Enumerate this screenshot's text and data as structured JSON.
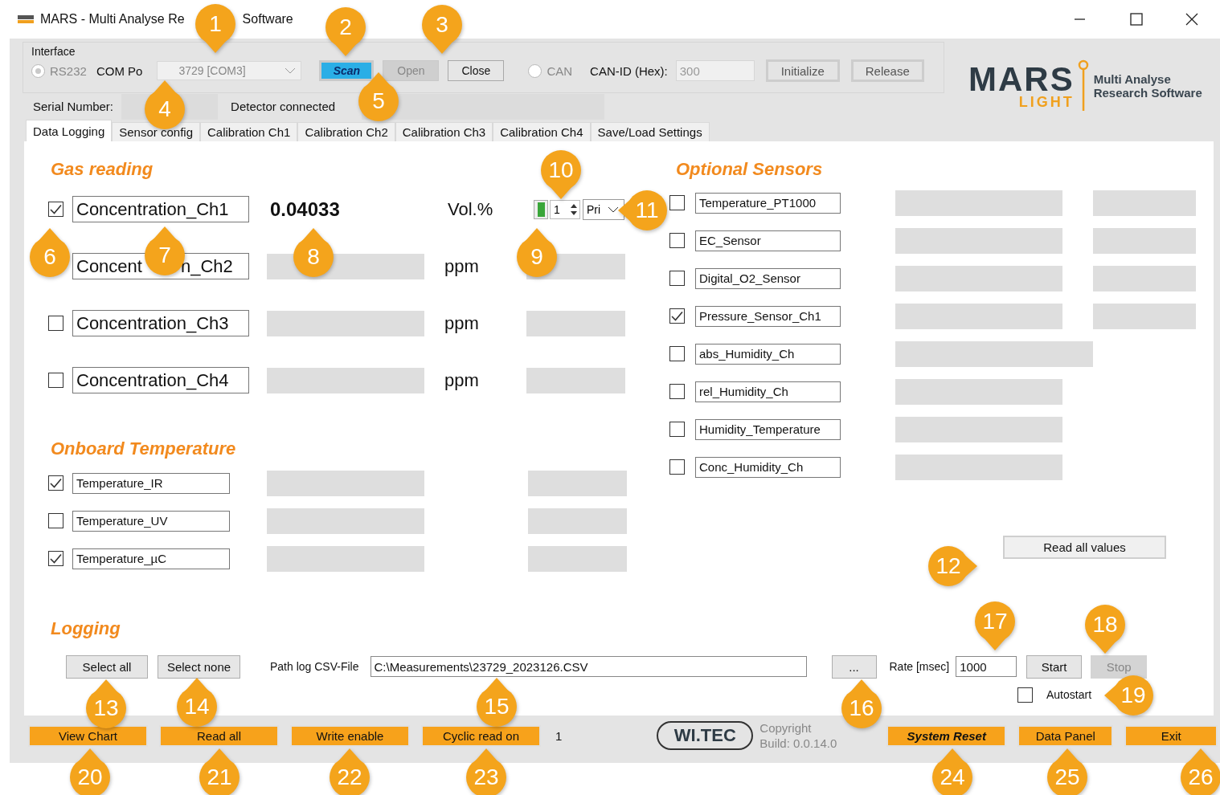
{
  "window": {
    "title_parts": [
      "MARS - Multi Analyse Re",
      "Software"
    ]
  },
  "interface": {
    "label": "Interface",
    "rs232": {
      "label": "RS232",
      "selected": true,
      "disabled": true
    },
    "com_port_label": "COM Po",
    "com_port": "3729 [COM3]",
    "buttons": [
      {
        "label": "Scan",
        "kind": "primary"
      },
      {
        "label": "Open",
        "kind": "disabled"
      },
      {
        "label": "Close",
        "kind": "normal"
      }
    ],
    "can": {
      "label": "CAN",
      "selected": false,
      "disabled": true
    },
    "can_id_label": "CAN-ID (Hex):",
    "can_id": "300",
    "can_buttons": [
      {
        "label": "Initialize"
      },
      {
        "label": "Release"
      }
    ]
  },
  "status": {
    "serial_label": "Serial Number:",
    "detector_label": "Detector connected"
  },
  "logo": {
    "name": "MARS",
    "sub": "LIGHT",
    "tagline": [
      "Multi Analyse",
      "Research Software"
    ]
  },
  "tabs": [
    {
      "label": "Data Logging",
      "selected": true
    },
    {
      "label": "Sensor config",
      "selected": false
    },
    {
      "label": "Calibration Ch1",
      "selected": false
    },
    {
      "label": "Calibration Ch2",
      "selected": false
    },
    {
      "label": "Calibration Ch3",
      "selected": false
    },
    {
      "label": "Calibration Ch4",
      "selected": false
    },
    {
      "label": "Save/Load Settings",
      "selected": false
    }
  ],
  "gas_reading": {
    "title": "Gas reading",
    "rows": [
      {
        "checked": true,
        "label_parts": [
          "Concentration_Ch1"
        ],
        "value": "0.04033",
        "unit": "Vol.%",
        "kind": "control"
      },
      {
        "label_parts": [
          "Concent",
          "n_Ch2"
        ],
        "unit": "ppm",
        "kind": "field"
      },
      {
        "checked": false,
        "label_parts": [
          "Concentration_Ch3"
        ],
        "unit": "ppm",
        "kind": "field"
      },
      {
        "checked": false,
        "label_parts": [
          "Concentration_Ch4"
        ],
        "unit": "ppm",
        "kind": "field"
      }
    ],
    "channel_control": {
      "indicator_on": true,
      "spin_value": "1",
      "select": "Pri"
    }
  },
  "onboard": {
    "title": "Onboard Temperature",
    "rows": [
      {
        "checked": true,
        "label": "Temperature_IR"
      },
      {
        "checked": false,
        "label": "Temperature_UV"
      },
      {
        "checked": true,
        "label": "Temperature_µC"
      }
    ]
  },
  "optional": {
    "title": "Optional Sensors",
    "read_all": "Read all values",
    "rows": [
      {
        "checked": false,
        "label": "Temperature_PT1000",
        "kind": "dual"
      },
      {
        "checked": false,
        "label": "EC_Sensor",
        "kind": "dual"
      },
      {
        "checked": false,
        "label": "Digital_O2_Sensor",
        "kind": "dual"
      },
      {
        "checked": true,
        "label": "Pressure_Sensor_Ch1",
        "kind": "dual"
      },
      {
        "checked": false,
        "label": "abs_Humidity_Ch",
        "kind": "wide"
      },
      {
        "checked": false,
        "label": "rel_Humidity_Ch",
        "kind": "single"
      },
      {
        "checked": false,
        "label": "Humidity_Temperature",
        "kind": "single"
      },
      {
        "checked": false,
        "label": "Conc_Humidity_Ch",
        "kind": "single"
      }
    ]
  },
  "logging": {
    "title": "Logging",
    "select_all": "Select all",
    "select_none": "Select none",
    "path_label": "Path log CSV-File",
    "path": "C:\\Measurements\\23729_2023126.CSV",
    "browse": "...",
    "rate_label": "Rate [msec]",
    "rate": "1000",
    "start": {
      "label": "Start",
      "disabled": false
    },
    "stop": {
      "label": "Stop",
      "disabled": true
    },
    "autostart": {
      "label": "Autostart",
      "checked": false
    }
  },
  "bottom_bar": {
    "buttons": [
      {
        "label": "View Chart"
      },
      {
        "label": "Read all"
      },
      {
        "label": "Write enable"
      },
      {
        "label": "Cyclic read on"
      }
    ],
    "counter": "1",
    "logo": "WI.TEC",
    "copyright": "Copyright",
    "build": "Build: 0.0.14.0",
    "right_buttons": [
      {
        "label": "System Reset",
        "kind": "emphasis"
      },
      {
        "label": "Data Panel",
        "kind": "normal"
      },
      {
        "label": "Exit",
        "kind": "normal"
      }
    ]
  },
  "callouts": [
    {
      "number": "1"
    },
    {
      "number": "2"
    },
    {
      "number": "3"
    },
    {
      "number": "4"
    },
    {
      "number": "5"
    },
    {
      "number": "6"
    },
    {
      "number": "7"
    },
    {
      "number": "8"
    },
    {
      "number": "9"
    },
    {
      "number": "10"
    },
    {
      "number": "11"
    },
    {
      "number": "12"
    },
    {
      "number": "13"
    },
    {
      "number": "14"
    },
    {
      "number": "15"
    },
    {
      "number": "16"
    },
    {
      "number": "17"
    },
    {
      "number": "18"
    },
    {
      "number": "19"
    },
    {
      "number": "20"
    },
    {
      "number": "21"
    },
    {
      "number": "22"
    },
    {
      "number": "23"
    },
    {
      "number": "24"
    },
    {
      "number": "25"
    },
    {
      "number": "26"
    }
  ]
}
